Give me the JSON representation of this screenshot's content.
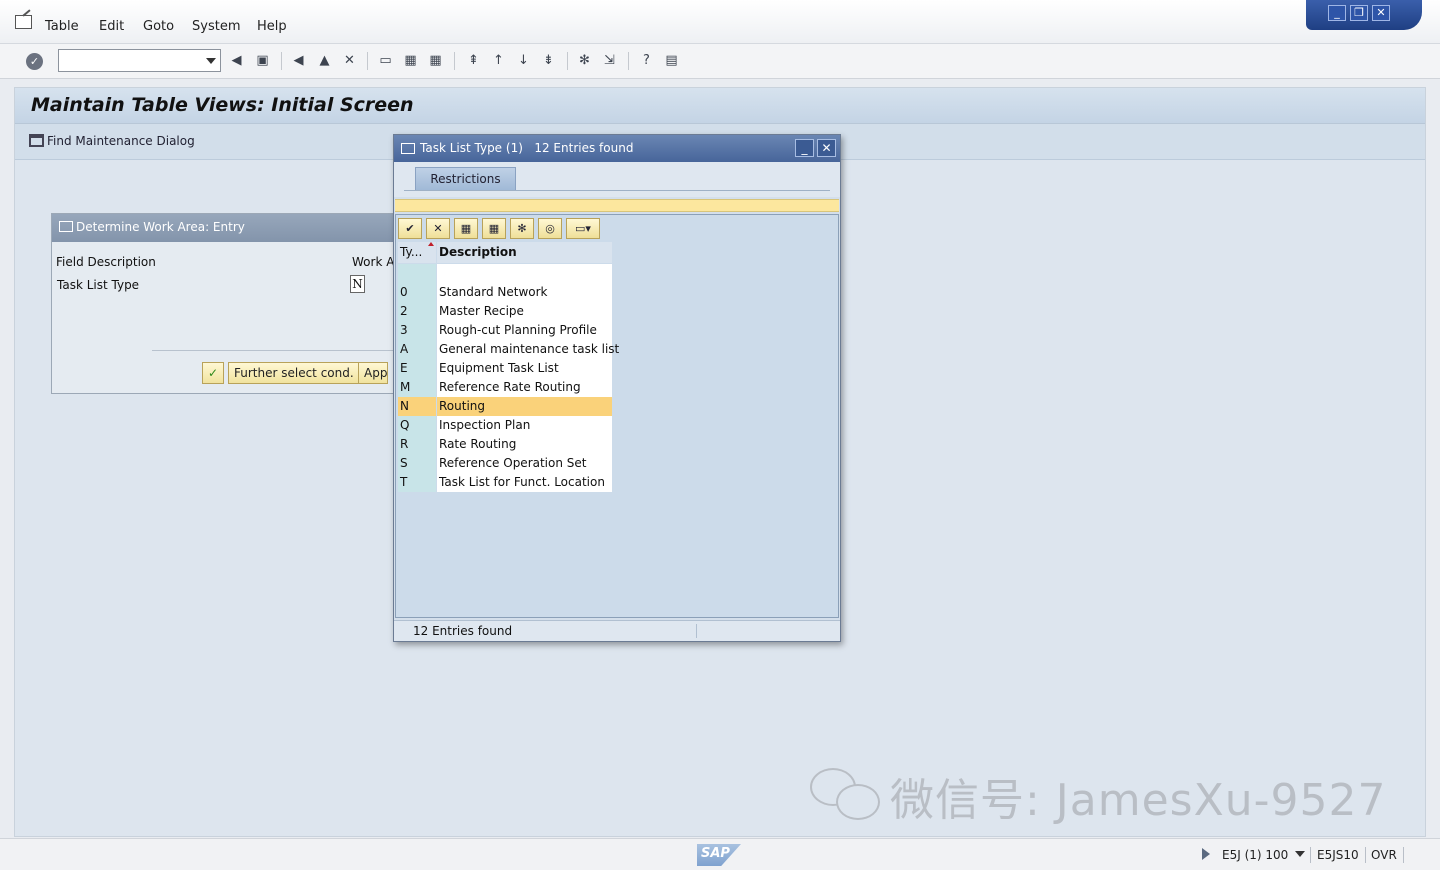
{
  "menu": {
    "items": [
      "Table",
      "Edit",
      "Goto",
      "System",
      "Help"
    ]
  },
  "toolbar": {
    "command_field": ""
  },
  "main": {
    "title": "Maintain Table Views: Initial Screen",
    "find_button_label": "Find Maintenance Dialog"
  },
  "work_area_dialog": {
    "title": "Determine Work Area: Entry",
    "field_description_label": "Field Description",
    "work_area_label": "Work A",
    "task_list_type_label": "Task List Type",
    "task_list_type_value": "N",
    "further_select_button": "Further select cond.",
    "append_button": "Appe"
  },
  "popup": {
    "title": "Task List Type (1)",
    "entries_found": "12 Entries found",
    "tab_restrictions": "Restrictions",
    "col_type": "Ty...",
    "col_description": "Description",
    "rows": [
      {
        "code": "0",
        "desc": "Standard Network"
      },
      {
        "code": "2",
        "desc": "Master Recipe"
      },
      {
        "code": "3",
        "desc": "Rough-cut Planning Profile"
      },
      {
        "code": "A",
        "desc": "General maintenance task list"
      },
      {
        "code": "E",
        "desc": "Equipment Task List"
      },
      {
        "code": "M",
        "desc": "Reference Rate Routing"
      },
      {
        "code": "N",
        "desc": "Routing",
        "selected": true
      },
      {
        "code": "Q",
        "desc": "Inspection Plan"
      },
      {
        "code": "R",
        "desc": "Rate Routing"
      },
      {
        "code": "S",
        "desc": "Reference Operation Set"
      },
      {
        "code": "T",
        "desc": "Task List for Funct. Location"
      }
    ],
    "status_text": "12 Entries found"
  },
  "watermark": {
    "text": "微信号: JamesXu-9527"
  },
  "statusbar": {
    "logo": "SAP",
    "session": "E5J (1) 100",
    "server": "E5JS10",
    "mode": "OVR"
  },
  "colors": {
    "selected_row": "#fad27a",
    "popup_title": "#47659a",
    "button_yellow": "#f1e39e"
  }
}
